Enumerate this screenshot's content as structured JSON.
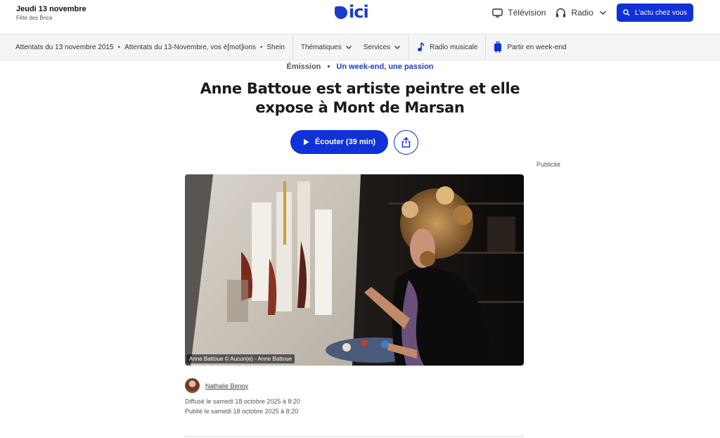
{
  "header": {
    "date": "Jeudi 13 novembre",
    "saint": "Fête des Brice",
    "logo": "ici",
    "television": "Télévision",
    "radio": "Radio",
    "cta": "L'actu chez vous"
  },
  "subnav": {
    "trends": [
      "Attentats du 13 novembre 2015",
      "Attentats du 13-Novembre, vos é[mot]ions",
      "Shein"
    ],
    "separator": "•",
    "thematiques": "Thématiques",
    "services": "Services",
    "radio_musicale": "Radio musicale",
    "partir": "Partir en week-end"
  },
  "article": {
    "type": "Émission",
    "separator": "•",
    "show": "Un week-end, une passion",
    "title": "Anne Battoue est artiste peintre et elle expose à Mont de Marsan",
    "listen_label": "Écouter (39 min)",
    "ad_label": "Publicité",
    "image_credit": "Anne Battoue © Aucun(e) - Anne Battoue",
    "author": "Nathalie Benoy",
    "broadcast": "Diffusé le samedi 18 octobre 2025 à 8:20",
    "published": "Publié le samedi 18 octobre 2025 à 8:20"
  },
  "colors": {
    "brand": "#1030d8",
    "logo": "#1c3cc9",
    "subnav_bg": "#f4f5f7"
  },
  "icons": {
    "television": "tv-icon",
    "radio": "headphones-icon",
    "search": "search-icon",
    "play": "play-icon",
    "share": "share-icon",
    "music": "music-note-icon",
    "luggage": "suitcase-icon"
  }
}
